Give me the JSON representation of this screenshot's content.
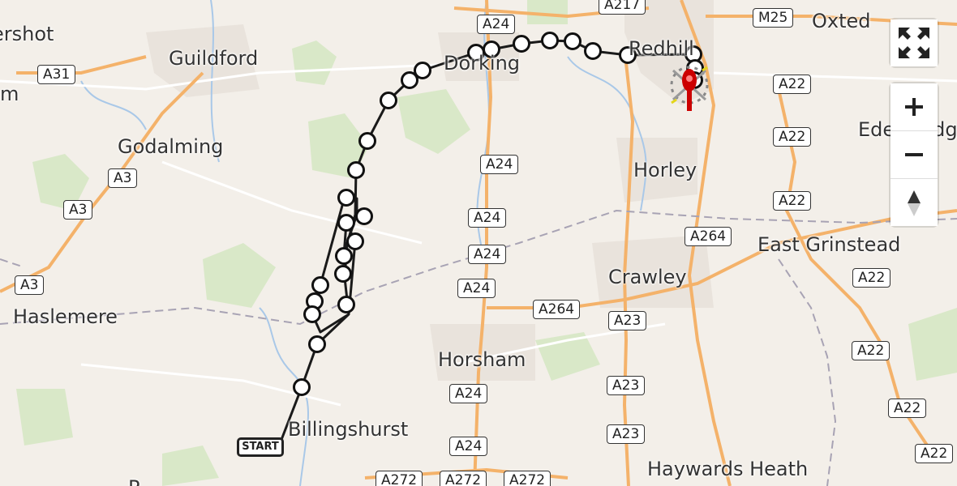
{
  "places": [
    {
      "name": "ershot"
    },
    {
      "name": "Guildford"
    },
    {
      "name": "m"
    },
    {
      "name": "Godalming"
    },
    {
      "name": "Haslemere"
    },
    {
      "name": "Billingshurst"
    },
    {
      "name": "Dorking"
    },
    {
      "name": "Redhill"
    },
    {
      "name": "Oxted"
    },
    {
      "name": "Horley"
    },
    {
      "name": "Edenbridge"
    },
    {
      "name": "East Grinstead"
    },
    {
      "name": "Crawley"
    },
    {
      "name": "Horsham"
    },
    {
      "name": "Haywards Heath"
    },
    {
      "name": "P"
    }
  ],
  "road_labels": [
    "A24",
    "A217",
    "M25",
    "A31",
    "A3",
    "A3",
    "A3",
    "A22",
    "A22",
    "A22",
    "A24",
    "A24",
    "A24",
    "A24",
    "A264",
    "A264",
    "A22",
    "A23",
    "A22",
    "A24",
    "A23",
    "A23",
    "A22",
    "A24",
    "A272",
    "A272",
    "A272",
    "A22"
  ],
  "route": {
    "start_label": "START"
  },
  "controls": {
    "fullscreen": "fullscreen",
    "zoom_in": "+",
    "zoom_out": "−",
    "reset_north": "reset-north"
  },
  "colors": {
    "land": "#f3efe9",
    "forest": "#d9e8c8",
    "water": "#a9c8e8",
    "major_road": "#f4b26a",
    "minor_road": "#ffffff",
    "route": "#1a1a1a",
    "boundary": "#a8a3b4",
    "marker": "#cc0000"
  }
}
